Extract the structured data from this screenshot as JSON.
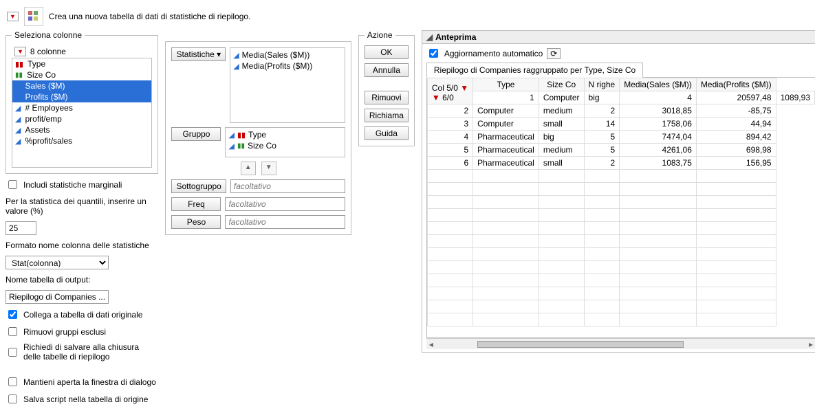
{
  "header": {
    "desc": "Crea una nuova tabella di dati di statistiche di riepilogo."
  },
  "left": {
    "fs_title": "Seleziona colonne",
    "count_label": "8 colonne",
    "columns": [
      {
        "name": "Type",
        "icon": "bars-red"
      },
      {
        "name": "Size Co",
        "icon": "bars-green"
      },
      {
        "name": "Sales ($M)",
        "icon": "tri-blue",
        "sel": true
      },
      {
        "name": "Profits ($M)",
        "icon": "tri-blue",
        "sel": true
      },
      {
        "name": "# Employees",
        "icon": "tri-blue"
      },
      {
        "name": "profit/emp",
        "icon": "tri-blue"
      },
      {
        "name": "Assets",
        "icon": "tri-blue"
      },
      {
        "name": "%profit/sales",
        "icon": "tri-blue"
      }
    ],
    "include_marginal": "Includi statistiche marginali",
    "quantile_label": "Per la statistica dei quantili, inserire un valore (%)",
    "quantile_value": "25",
    "format_label": "Formato nome colonna delle statistiche",
    "format_value": "Stat(colonna)",
    "outname_label": "Nome tabella di output:",
    "outname_value": "Riepilogo di Companies ...",
    "link_label": "Collega a tabella di dati originale",
    "remove_groups": "Rimuovi gruppi esclusi",
    "ask_save": "Richiedi di salvare alla chiusura delle tabelle di riepilogo",
    "keep_open": "Mantieni aperta la finestra di dialogo",
    "save_script": "Salva script nella tabella di origine"
  },
  "middle": {
    "stat_btn": "Statistiche",
    "stat_items": [
      "Media(Sales ($M))",
      "Media(Profits ($M))"
    ],
    "group_btn": "Gruppo",
    "group_items": [
      {
        "name": "Type",
        "icon": "bars-red"
      },
      {
        "name": "Size Co",
        "icon": "bars-green"
      }
    ],
    "subgroup_btn": "Sottogruppo",
    "freq_btn": "Freq",
    "weight_btn": "Peso",
    "placeholder": "facoltativo"
  },
  "actions": {
    "fs_title": "Azione",
    "ok": "OK",
    "cancel": "Annulla",
    "remove": "Rimuovi",
    "recall": "Richiama",
    "help": "Guida"
  },
  "preview": {
    "title": "Anteprima",
    "auto_label": "Aggiornamento automatico",
    "tab": "Riepilogo di Companies raggruppato per Type, Size Co",
    "col_indicator": "Col 5/0",
    "row_indicator": "6/0",
    "headers": [
      "Type",
      "Size Co",
      "N righe",
      "Media(Sales ($M))",
      "Media(Profits ($M))"
    ]
  },
  "chart_data": {
    "type": "table",
    "title": "Riepilogo di Companies raggruppato per Type, Size Co",
    "columns": [
      "Type",
      "Size Co",
      "N righe",
      "Media(Sales ($M))",
      "Media(Profits ($M))"
    ],
    "rows": [
      [
        "Computer",
        "big",
        4,
        "20597,48",
        "1089,93"
      ],
      [
        "Computer",
        "medium",
        2,
        "3018,85",
        "-85,75"
      ],
      [
        "Computer",
        "small",
        14,
        "1758,06",
        "44,94"
      ],
      [
        "Pharmaceutical",
        "big",
        5,
        "7474,04",
        "894,42"
      ],
      [
        "Pharmaceutical",
        "medium",
        5,
        "4261,06",
        "698,98"
      ],
      [
        "Pharmaceutical",
        "small",
        2,
        "1083,75",
        "156,95"
      ]
    ]
  }
}
